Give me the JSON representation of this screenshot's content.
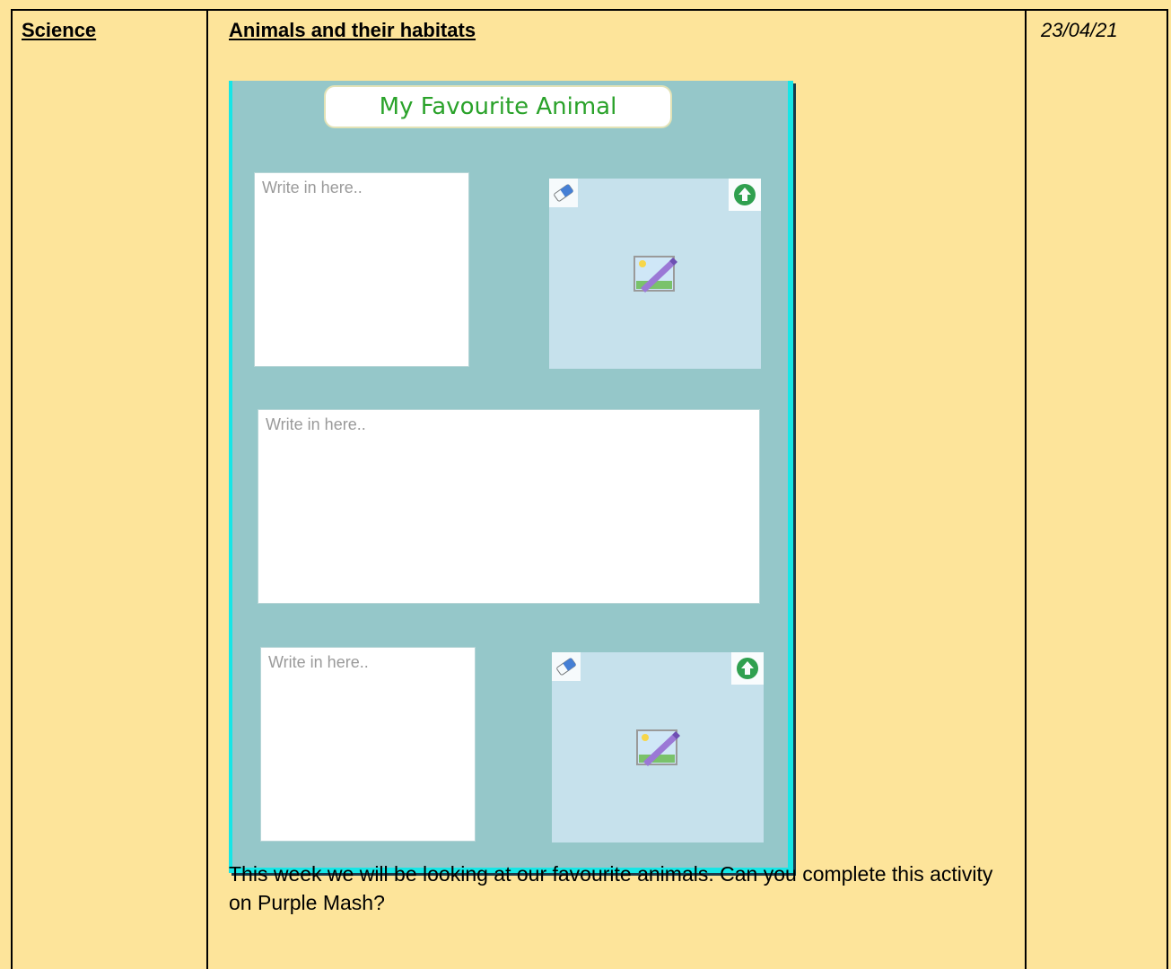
{
  "header": {
    "subject": "Science",
    "topic": "Animals and their habitats",
    "date": "23/04/21"
  },
  "activity": {
    "title": "My Favourite Animal",
    "textbox_placeholder": "Write in here.."
  },
  "instructions": "This week we will be looking at our favourite animals.  Can you complete this activity on Purple Mash?",
  "icons": [
    "eraser-icon",
    "upload-icon",
    "picture-icon"
  ],
  "colors": {
    "page_bg": "#fde49a",
    "activity_bg": "#95c7c9",
    "activity_border": "#16e6e6",
    "title_text": "#2aa22a",
    "image_box_bg": "#c6e1ec",
    "upload_green": "#1f9a3f"
  }
}
